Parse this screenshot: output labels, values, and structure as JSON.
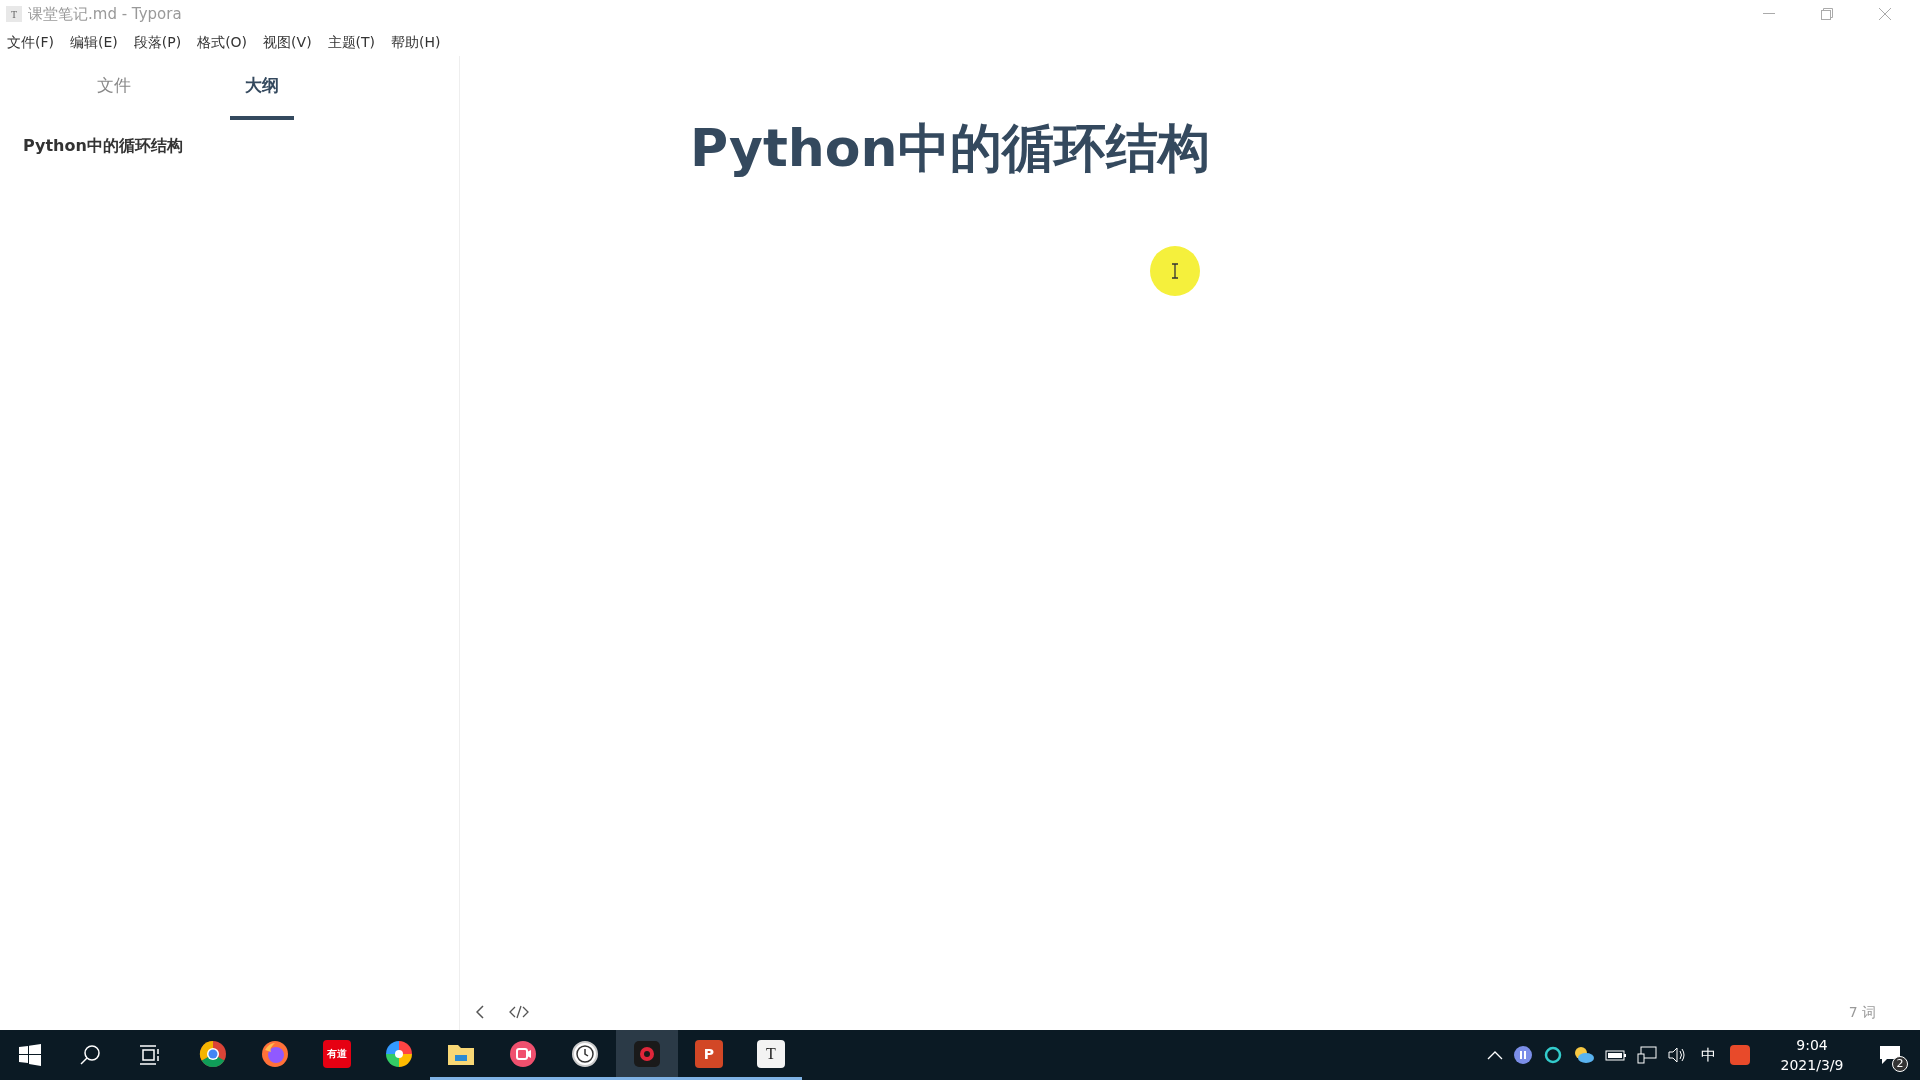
{
  "window": {
    "title": "课堂笔记.md - Typora",
    "app_icon_letter": "T"
  },
  "menu": [
    "文件(F)",
    "编辑(E)",
    "段落(P)",
    "格式(O)",
    "视图(V)",
    "主题(T)",
    "帮助(H)"
  ],
  "sidebar": {
    "tabs": [
      {
        "label": "文件",
        "selected": false
      },
      {
        "label": "大纲",
        "selected": true
      }
    ],
    "outline": [
      {
        "label": "Python中的循环结构",
        "selected": false
      }
    ]
  },
  "editor": {
    "heading": "Python中的循环结构"
  },
  "footer": {
    "word_count": "7 词"
  },
  "taskbar": {
    "apps": [
      {
        "kind": "chrome",
        "running": false,
        "selected": false
      },
      {
        "kind": "firefox",
        "running": false,
        "selected": false
      },
      {
        "kind": "youdao",
        "label": "有道",
        "running": false,
        "selected": false
      },
      {
        "kind": "pinwheel",
        "running": false,
        "selected": false
      },
      {
        "kind": "folder",
        "running": true,
        "selected": false
      },
      {
        "kind": "recorder",
        "running": true,
        "selected": false
      },
      {
        "kind": "clock",
        "running": true,
        "selected": false
      },
      {
        "kind": "record",
        "running": true,
        "selected": true
      },
      {
        "kind": "powerpoint",
        "label": "P",
        "running": true,
        "selected": false
      },
      {
        "kind": "typora",
        "label": "T",
        "running": true,
        "selected": false
      }
    ],
    "input_method": "中",
    "time": "9:04",
    "date": "2021/3/9",
    "notification_count": "2"
  }
}
